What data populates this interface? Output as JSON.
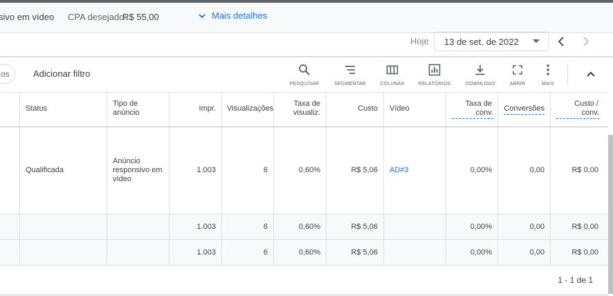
{
  "info_bar": {
    "ad_type_partial": "sivo em vídeo",
    "cpa_label": "CPA desejado:",
    "cpa_value": "R$ 55,00",
    "more_details": "Mais detalhes"
  },
  "date_bar": {
    "today_label": "Hoje",
    "date_value": "13 de set. de 2022"
  },
  "toolbar": {
    "chip_label": "os",
    "add_filter": "Adicionar filtro",
    "tools": [
      {
        "label": "PESQUISAR",
        "icon": "search-icon"
      },
      {
        "label": "SEGMENTAR",
        "icon": "segment-icon"
      },
      {
        "label": "COLUNAS",
        "icon": "columns-icon"
      },
      {
        "label": "RELATÓRIOS",
        "icon": "reports-icon"
      },
      {
        "label": "DOWNLOAD",
        "icon": "download-icon"
      },
      {
        "label": "ABRIR",
        "icon": "fullscreen-icon"
      },
      {
        "label": "MAIS",
        "icon": "more-vert-icon"
      }
    ]
  },
  "table": {
    "headers": [
      "Status",
      "Tipo de anúncio",
      "Impr.",
      "Visualizações",
      "Taxa de visualiz.",
      "Custo",
      "Vídeo",
      "Taxa de conv.",
      "Conversões",
      "Custo / conv."
    ],
    "headers_display": {
      "tipo_line1": "Tipo de",
      "tipo_line2": "anúncio",
      "taxa_vis_line1": "Taxa de",
      "taxa_vis_line2": "visualiz.",
      "taxa_conv_line1": "Taxa de",
      "taxa_conv_line2": "conv.",
      "custo_conv_line1": "Custo /",
      "custo_conv_line2": "conv."
    },
    "row": {
      "status": "Qualificada",
      "ad_type_line1": "Anúncio",
      "ad_type_line2": "responsivo em",
      "ad_type_line3": "vídeo",
      "impr": "1.003",
      "views": "6",
      "view_rate": "0,60%",
      "cost": "R$ 5,06",
      "video": "AD#3",
      "conv_rate": "0,00%",
      "conversions": "0,00",
      "cost_per_conv": "R$ 0,00"
    },
    "totals": [
      {
        "impr": "1.003",
        "views": "6",
        "view_rate": "0,60%",
        "cost": "R$ 5,06",
        "conv_rate": "0,00%",
        "conversions": "0,00",
        "cost_per_conv": "R$ 0,00"
      },
      {
        "impr": "1.003",
        "views": "6",
        "view_rate": "0,60%",
        "cost": "R$ 5,06",
        "conv_rate": "0,00%",
        "conversions": "0,00",
        "cost_per_conv": "R$ 0,00"
      }
    ]
  },
  "pagination": "1 - 1 de 1",
  "colors": {
    "accent": "#1a73e8",
    "text": "#3c4043",
    "muted": "#5f6368"
  }
}
